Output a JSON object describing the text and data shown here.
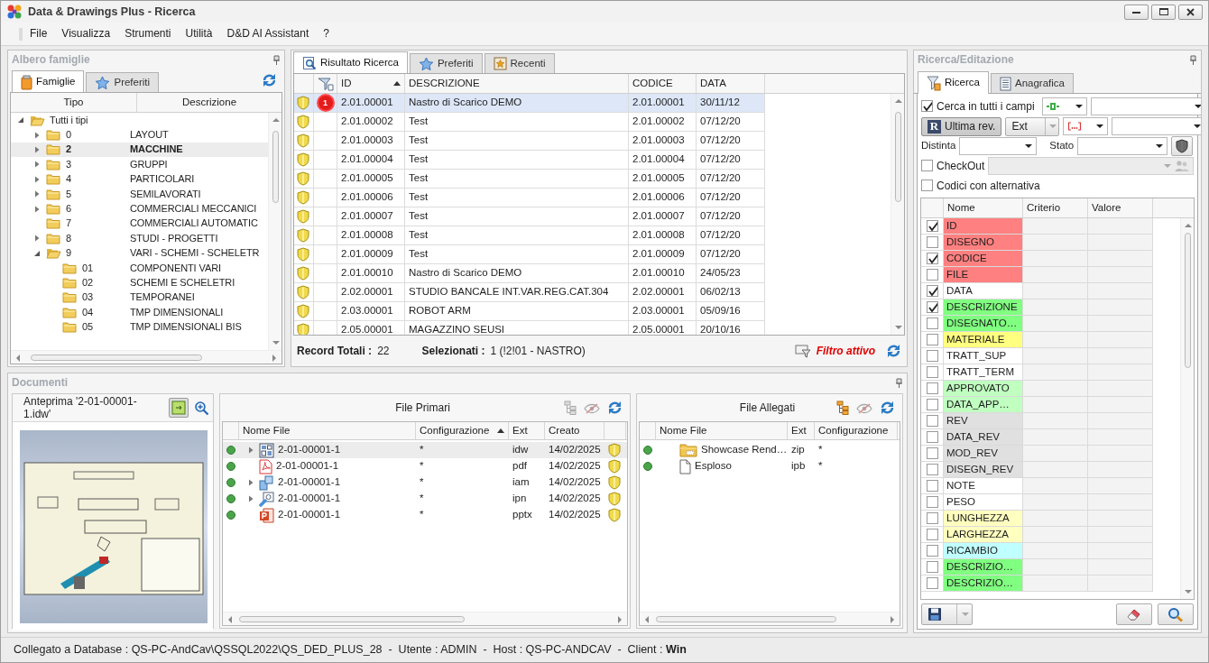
{
  "window": {
    "title": "Data & Drawings Plus - Ricerca"
  },
  "menu": [
    "File",
    "Visualizza",
    "Strumenti",
    "Utilità",
    "D&D AI Assistant",
    "?"
  ],
  "family_panel": {
    "title": "Albero famiglie",
    "tabs": [
      {
        "label": "Famiglie",
        "selected": true,
        "kind": "families"
      },
      {
        "label": "Preferiti",
        "selected": false,
        "kind": "favorites"
      }
    ],
    "columns": [
      "Tipo",
      "Descrizione"
    ],
    "tree": [
      {
        "code": "Tutti i tipi",
        "expanded": true,
        "selected": false,
        "children": [
          {
            "code": "0",
            "description": "LAYOUT",
            "expanded": false,
            "selected": false
          },
          {
            "code": "2",
            "description": "MACCHINE",
            "expanded": false,
            "selected": true
          },
          {
            "code": "3",
            "description": "GRUPPI",
            "expanded": false,
            "selected": false
          },
          {
            "code": "4",
            "description": "PARTICOLARI",
            "expanded": false,
            "selected": false
          },
          {
            "code": "5",
            "description": "SEMILAVORATI",
            "expanded": false,
            "selected": false
          },
          {
            "code": "6",
            "description": "COMMERCIALI MECCANICI",
            "expanded": false,
            "selected": false
          },
          {
            "code": "7",
            "description": "COMMERCIALI AUTOMATIC",
            "selected": false
          },
          {
            "code": "8",
            "description": "STUDI - PROGETTI",
            "expanded": false,
            "selected": false
          },
          {
            "code": "9",
            "description": "VARI - SCHEMI - SCHELETR",
            "expanded": true,
            "selected": false,
            "children": [
              {
                "code": "01",
                "description": "COMPONENTI VARI",
                "selected": false
              },
              {
                "code": "02",
                "description": "SCHEMI E SCHELETRI",
                "selected": false
              },
              {
                "code": "03",
                "description": "TEMPORANEI",
                "selected": false
              },
              {
                "code": "04",
                "description": "TMP DIMENSIONALI",
                "selected": false
              },
              {
                "code": "05",
                "description": "TMP DIMENSIONALI BIS",
                "selected": false
              }
            ]
          }
        ]
      }
    ]
  },
  "results": {
    "tabs": [
      {
        "label": "Risultato Ricerca",
        "selected": true,
        "kind": "results"
      },
      {
        "label": "Preferiti",
        "selected": false,
        "kind": "favorites"
      },
      {
        "label": "Recenti",
        "selected": false,
        "kind": "recent"
      }
    ],
    "columns": [
      {
        "label": "ID",
        "sorted": true
      },
      {
        "label": "DESCRIZIONE",
        "sorted": false
      },
      {
        "label": "CODICE",
        "sorted": false
      },
      {
        "label": "DATA",
        "sorted": false
      }
    ],
    "rows": [
      {
        "cells": [
          "2.01.00001",
          "Nastro di Scarico DEMO",
          "2.01.00001",
          "30/11/12"
        ],
        "selected": true,
        "badge": "1"
      },
      {
        "cells": [
          "2.01.00002",
          "Test",
          "2.01.00002",
          "07/12/20"
        ],
        "selected": false
      },
      {
        "cells": [
          "2.01.00003",
          "Test",
          "2.01.00003",
          "07/12/20"
        ],
        "selected": false
      },
      {
        "cells": [
          "2.01.00004",
          "Test",
          "2.01.00004",
          "07/12/20"
        ],
        "selected": false
      },
      {
        "cells": [
          "2.01.00005",
          "Test",
          "2.01.00005",
          "07/12/20"
        ],
        "selected": false
      },
      {
        "cells": [
          "2.01.00006",
          "Test",
          "2.01.00006",
          "07/12/20"
        ],
        "selected": false
      },
      {
        "cells": [
          "2.01.00007",
          "Test",
          "2.01.00007",
          "07/12/20"
        ],
        "selected": false
      },
      {
        "cells": [
          "2.01.00008",
          "Test",
          "2.01.00008",
          "07/12/20"
        ],
        "selected": false
      },
      {
        "cells": [
          "2.01.00009",
          "Test",
          "2.01.00009",
          "07/12/20"
        ],
        "selected": false
      },
      {
        "cells": [
          "2.01.00010",
          "Nastro di Scarico DEMO",
          "2.01.00010",
          "24/05/23"
        ],
        "selected": false
      },
      {
        "cells": [
          "2.02.00001",
          "STUDIO BANCALE INT.VAR.REG.CAT.304",
          "2.02.00001",
          "06/02/13"
        ],
        "selected": false
      },
      {
        "cells": [
          "2.03.00001",
          "ROBOT ARM",
          "2.03.00001",
          "05/09/16"
        ],
        "selected": false
      },
      {
        "cells": [
          "2.05.00001",
          "MAGAZZINO SEUSI",
          "2.05.00001",
          "20/10/16"
        ],
        "selected": false
      }
    ],
    "footer": {
      "total_label": "Record Totali :",
      "total": "22",
      "selected_label": "Selezionati :",
      "selected_value": "1 (!2!01 - NASTRO)",
      "filter": "Filtro attivo"
    }
  },
  "search_panel": {
    "title": "Ricerca/Editazione",
    "tabs": [
      {
        "label": "Ricerca",
        "selected": true,
        "kind": "search"
      },
      {
        "label": "Anagrafica",
        "selected": false,
        "kind": "registry"
      }
    ],
    "search_all": {
      "label": "Cerca in tutti i campi",
      "checked": true
    },
    "latest_rev": {
      "letter": "R",
      "label": "Ultima rev.",
      "pressed": true
    },
    "ext_button": "Ext",
    "distinta_label": "Distinta",
    "stato_label": "Stato",
    "checkout": {
      "label": "CheckOut",
      "checked": false
    },
    "alternatives": {
      "label": "Codici con alternativa",
      "checked": false
    },
    "field_columns": [
      "Nome",
      "Criterio",
      "Valore"
    ],
    "fields": [
      {
        "name": "ID",
        "checked": true,
        "color": "#ff8080"
      },
      {
        "name": "DISEGNO",
        "checked": false,
        "color": "#ff8080"
      },
      {
        "name": "CODICE",
        "checked": true,
        "color": "#ff8080"
      },
      {
        "name": "FILE",
        "checked": false,
        "color": "#ff8080"
      },
      {
        "name": "DATA",
        "checked": true,
        "color": "#ffffff"
      },
      {
        "name": "DESCRIZIONE",
        "checked": true,
        "color": "#80ff80"
      },
      {
        "name": "DISEGNATO…",
        "checked": false,
        "color": "#80ff80"
      },
      {
        "name": "MATERIALE",
        "checked": false,
        "color": "#ffff80"
      },
      {
        "name": "TRATT_SUP",
        "checked": false,
        "color": "#ffffff"
      },
      {
        "name": "TRATT_TERM",
        "checked": false,
        "color": "#ffffff"
      },
      {
        "name": "APPROVATO",
        "checked": false,
        "color": "#c0ffc0"
      },
      {
        "name": "DATA_APP…",
        "checked": false,
        "color": "#c0ffc0"
      },
      {
        "name": "REV",
        "checked": false,
        "color": "#e0e0e0"
      },
      {
        "name": "DATA_REV",
        "checked": false,
        "color": "#e0e0e0"
      },
      {
        "name": "MOD_REV",
        "checked": false,
        "color": "#e0e0e0"
      },
      {
        "name": "DISEGN_REV",
        "checked": false,
        "color": "#e0e0e0"
      },
      {
        "name": "NOTE",
        "checked": false,
        "color": "#ffffff"
      },
      {
        "name": "PESO",
        "checked": false,
        "color": "#ffffff"
      },
      {
        "name": "LUNGHEZZA",
        "checked": false,
        "color": "#ffffc0"
      },
      {
        "name": "LARGHEZZA",
        "checked": false,
        "color": "#ffffc0"
      },
      {
        "name": "RICAMBIO",
        "checked": false,
        "color": "#c0ffff"
      },
      {
        "name": "DESCRIZIO…",
        "checked": false,
        "color": "#80ff80"
      },
      {
        "name": "DESCRIZIO…",
        "checked": false,
        "color": "#80ff80"
      }
    ]
  },
  "documents": {
    "title": "Documenti",
    "preview": {
      "title": "Anteprima '2-01-00001-1.idw'",
      "fit_pressed": true
    },
    "primary": {
      "title": "File Primari",
      "tools": [
        {
          "kind": "tree",
          "enabled": false
        },
        {
          "kind": "hidden",
          "enabled": false
        },
        {
          "kind": "refresh",
          "enabled": true
        }
      ],
      "columns": [
        {
          "label": "Nome File",
          "sorted": false
        },
        {
          "label": "Configurazione",
          "sorted": true
        },
        {
          "label": "Ext",
          "sorted": false
        },
        {
          "label": "Creato",
          "sorted": false
        }
      ],
      "rows": [
        {
          "kind": "drawing",
          "expanded": false,
          "selected": true,
          "cells": [
            "2-01-00001-1",
            "*",
            "idw",
            "14/02/2025"
          ]
        },
        {
          "kind": "pdf",
          "selected": false,
          "cells": [
            "2-01-00001-1",
            "*",
            "pdf",
            "14/02/2025"
          ]
        },
        {
          "kind": "assembly",
          "expanded": false,
          "selected": false,
          "cells": [
            "2-01-00001-1",
            "*",
            "iam",
            "14/02/2025"
          ]
        },
        {
          "kind": "presentation",
          "expanded": false,
          "selected": false,
          "cells": [
            "2-01-00001-1",
            "*",
            "ipn",
            "14/02/2025"
          ]
        },
        {
          "kind": "slides",
          "selected": false,
          "cells": [
            "2-01-00001-1",
            "*",
            "pptx",
            "14/02/2025"
          ]
        }
      ]
    },
    "attachments": {
      "title": "File Allegati",
      "tools": [
        {
          "kind": "tree",
          "enabled": true
        },
        {
          "kind": "hidden",
          "enabled": false
        },
        {
          "kind": "refresh",
          "enabled": true
        }
      ],
      "columns": [
        {
          "label": "Nome File",
          "sorted": false
        },
        {
          "label": "Ext",
          "sorted": false
        },
        {
          "label": "Configurazione",
          "sorted": false
        }
      ],
      "rows": [
        {
          "kind": "zip",
          "selected": false,
          "cells": [
            "Showcase Rend…",
            "zip",
            "*"
          ]
        },
        {
          "kind": "blank",
          "selected": false,
          "cells": [
            "Esploso",
            "ipb",
            "*"
          ]
        }
      ]
    }
  },
  "status_bar": "Collegato a Database : QS-PC-AndCav\\QSSQL2022\\QS_DED_PLUS_28  -  Utente : ADMIN  -  Host : QS-PC-ANDCAV  -  Client : **Win**"
}
